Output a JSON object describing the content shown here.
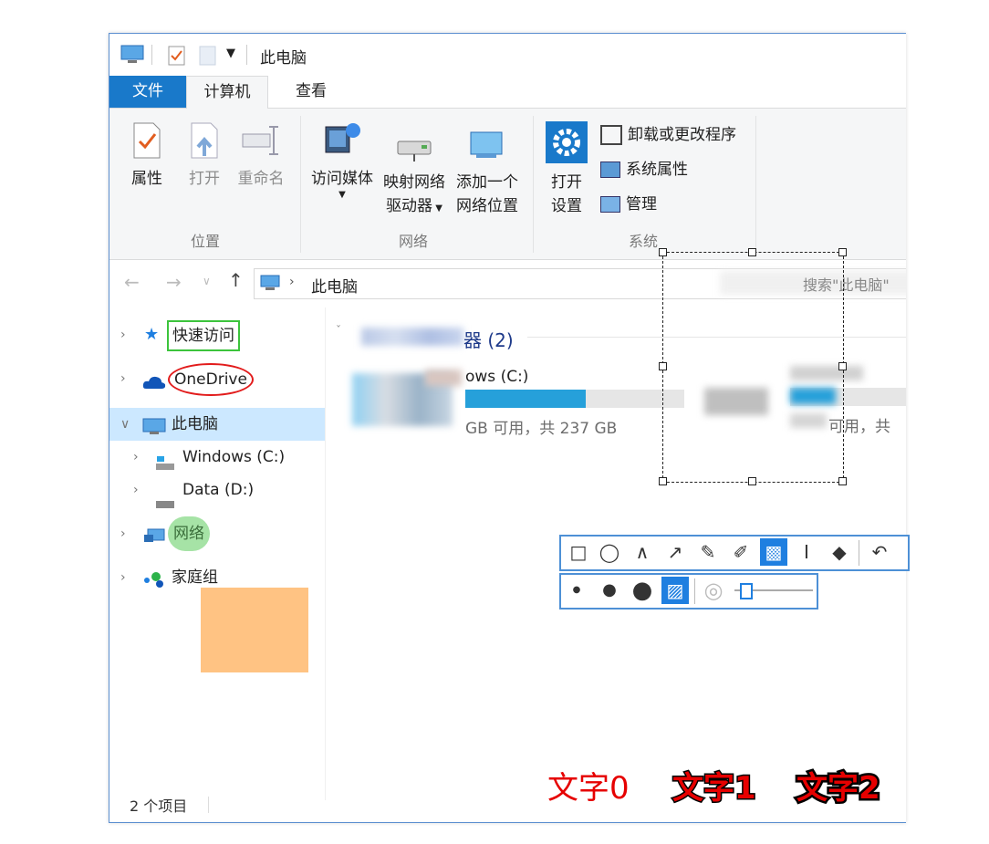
{
  "window": {
    "title": "此电脑",
    "tabs": [
      {
        "label": "文件"
      },
      {
        "label": "计算机"
      },
      {
        "label": "查看"
      }
    ]
  },
  "ribbon": {
    "location_group": {
      "label": "位置",
      "properties": "属性",
      "open": "打开",
      "rename": "重命名"
    },
    "network_group": {
      "label": "网络",
      "access_media": "访问媒体",
      "map_drive_line1": "映射网络",
      "map_drive_line2": "驱动器",
      "add_location_line1": "添加一个",
      "add_location_line2": "网络位置"
    },
    "system_group": {
      "label": "系统",
      "open_settings_line1": "打开",
      "open_settings_line2": "设置",
      "uninstall": "卸载或更改程序",
      "system_properties": "系统属性",
      "manage": "管理"
    }
  },
  "address": {
    "path": "此电脑",
    "search_placeholder": "搜索\"此电脑\""
  },
  "sidebar": {
    "items": [
      {
        "label": "快速访问"
      },
      {
        "label": "OneDrive"
      },
      {
        "label": "此电脑"
      },
      {
        "label": "Windows (C:)"
      },
      {
        "label": "Data (D:)"
      },
      {
        "label": "网络"
      },
      {
        "label": "家庭组"
      }
    ]
  },
  "content": {
    "section_title": "设备和驱动器 (2)",
    "section_visible": "器 (2)",
    "drive_c": {
      "name_visible": "ows (C:)",
      "usage_visible": "GB 可用，共 237 GB",
      "fill": 0.55
    },
    "drive_d": {
      "name_visible": "Data (D:)",
      "usage_visible": "可用，共"
    }
  },
  "status": {
    "count": "2 个项目"
  },
  "annotations": {
    "text0": "文字0",
    "text1": "文字1",
    "text2": "文字2"
  },
  "colors": {
    "accent": "#1979ca",
    "selection": "#cce8ff",
    "annotation_red": "#e60000",
    "highlight_green": "#a6e3a6",
    "highlight_orange": "#ffbe78"
  }
}
